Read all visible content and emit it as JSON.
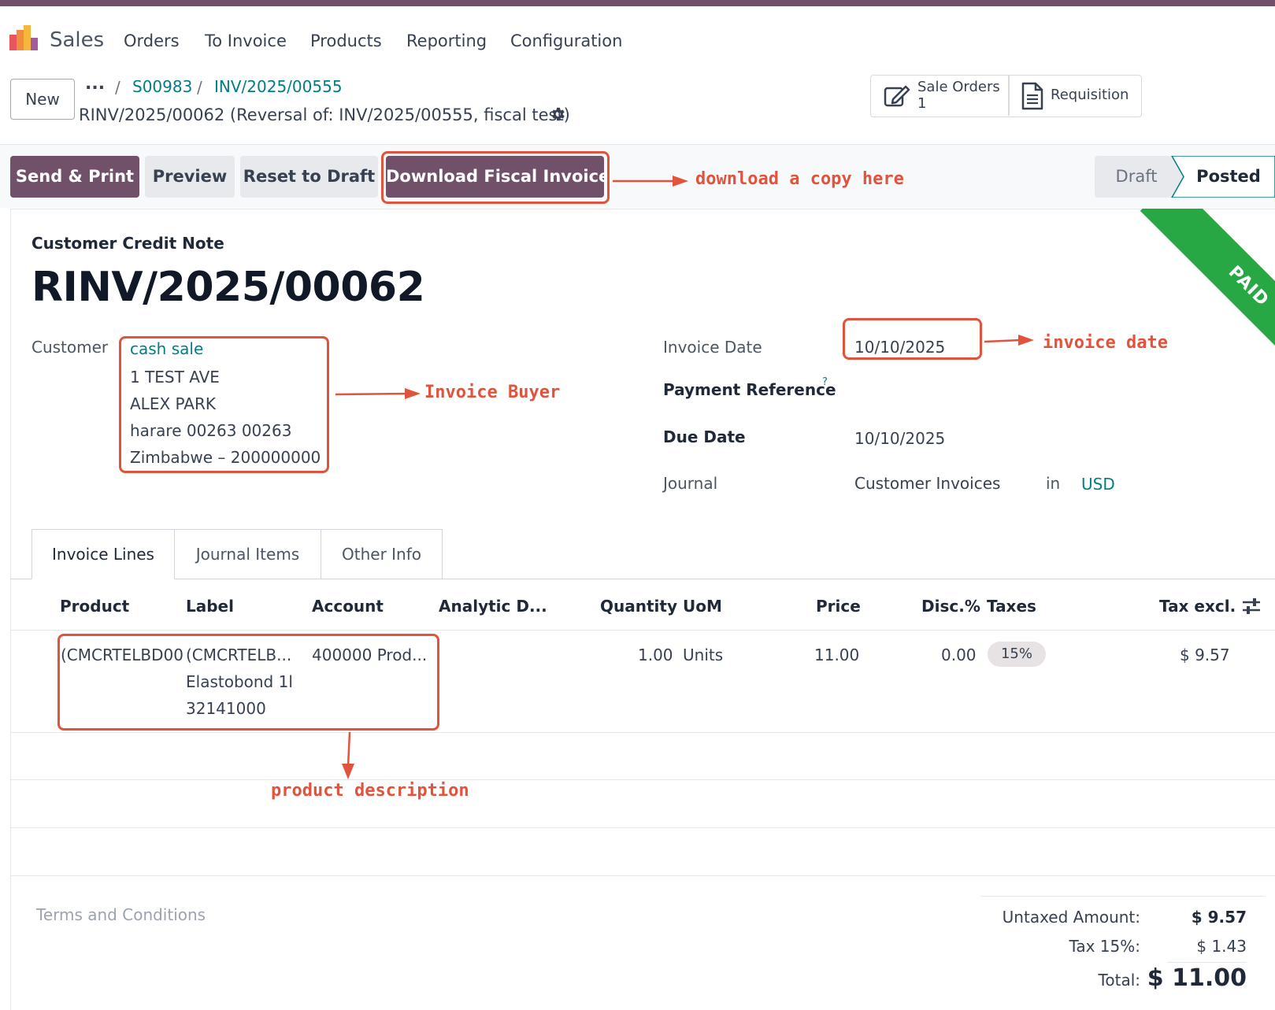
{
  "navbar": {
    "app_name": "Sales",
    "menu": [
      "Orders",
      "To Invoice",
      "Products",
      "Reporting",
      "Configuration"
    ]
  },
  "control_panel": {
    "new_label": "New",
    "breadcrumb_ellipsis": "...",
    "breadcrumb": [
      "S00983",
      "INV/2025/00555"
    ],
    "breadcrumb_sep": "/",
    "record_title": "RINV/2025/00062 (Reversal of: INV/2025/00555, fiscal test)",
    "smart_buttons": {
      "sale_orders_label": "Sale Orders",
      "sale_orders_count": "1",
      "requisition_label": "Requisition"
    }
  },
  "actions": {
    "send_print": "Send & Print",
    "preview": "Preview",
    "reset_draft": "Reset to Draft",
    "download_fiscal": "Download Fiscal Invoice"
  },
  "statusbar": {
    "draft": "Draft",
    "posted": "Posted",
    "active": "Posted"
  },
  "ribbon": "PAID",
  "form": {
    "doc_type": "Customer Credit Note",
    "name": "RINV/2025/00062",
    "customer_label": "Customer",
    "customer_name": "cash sale",
    "customer_address": [
      "1 TEST AVE",
      "ALEX PARK",
      "harare 00263 00263",
      "Zimbabwe – 200000000"
    ],
    "invoice_date_label": "Invoice Date",
    "invoice_date": "10/10/2025",
    "payment_ref_label": "Payment Reference",
    "payment_ref_help": "?",
    "due_date_label": "Due Date",
    "due_date": "10/10/2025",
    "journal_label": "Journal",
    "journal": "Customer Invoices",
    "journal_in": "in",
    "currency": "USD"
  },
  "tabs": [
    "Invoice Lines",
    "Journal Items",
    "Other Info"
  ],
  "lines_table": {
    "columns": [
      "Product",
      "Label",
      "Account",
      "Analytic D...",
      "Quantity",
      "UoM",
      "Price",
      "Disc.%",
      "Taxes",
      "Tax excl."
    ],
    "rows": [
      {
        "product": "(CMCRTELBD00",
        "label_lines": [
          "(CMCRTELB...",
          "Elastobond 1l",
          "32141000"
        ],
        "account": "400000 Prod...",
        "quantity": "1.00",
        "uom": "Units",
        "price": "11.00",
        "discount": "0.00",
        "taxes": "15%",
        "subtotal": "$ 9.57"
      }
    ]
  },
  "footer": {
    "terms_placeholder": "Terms and Conditions",
    "untaxed_label": "Untaxed Amount:",
    "untaxed_value": "$ 9.57",
    "tax_label": "Tax 15%:",
    "tax_value": "$ 1.43",
    "total_label": "Total:",
    "total_value": "$ 11.00"
  },
  "annotations": {
    "download": "download a copy here",
    "invoice_date": "invoice date",
    "buyer": "Invoice Buyer",
    "product": "product description"
  },
  "colors": {
    "brand": "#71506a",
    "link": "#017e84",
    "annotation": "#e1533c",
    "paid_ribbon": "#28a745"
  }
}
